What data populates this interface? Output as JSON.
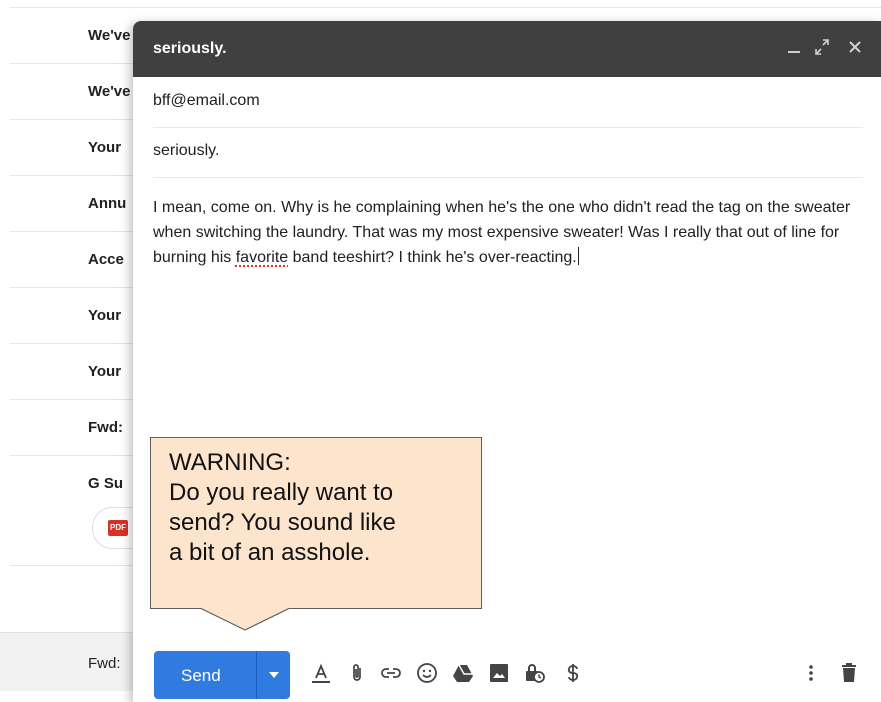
{
  "inbox": {
    "rows": [
      {
        "subject": "We've"
      },
      {
        "subject": "We've"
      },
      {
        "subject": "Your"
      },
      {
        "subject": "Annu"
      },
      {
        "subject": "Acce"
      },
      {
        "subject": "Your"
      },
      {
        "subject": "Your"
      },
      {
        "subject": "Fwd:"
      },
      {
        "subject": "G Su"
      }
    ],
    "attachment_label": "PDF",
    "bottom_subject": "Fwd:"
  },
  "compose": {
    "title": "seriously.",
    "to": "bff@email.com",
    "subject": "seriously.",
    "body": {
      "before": "I mean, come on. Why is he complaining when he's the one who didn't read the tag on the sweater when switching the laundry. That was my most expensive sweater! Was I really that out of line for burning his ",
      "misspelled": "favorite",
      "after": " band teeshirt? I think he's over-reacting."
    },
    "send_label": "Send"
  },
  "warning": {
    "title": "WARNING:",
    "lines": [
      "Do you really want to",
      "send? You sound like",
      "a bit of an asshole."
    ]
  },
  "colors": {
    "header": "#404040",
    "send_button": "#2f7be0",
    "warning_bg": "#fde5cd"
  }
}
